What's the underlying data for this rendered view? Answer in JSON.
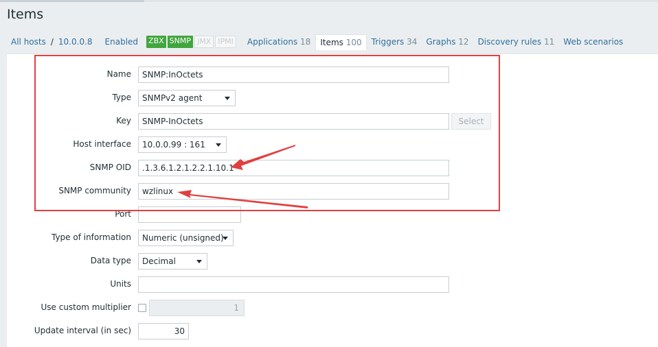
{
  "page": {
    "title": "Items"
  },
  "nav": {
    "all_hosts": "All hosts",
    "separator": "/",
    "host": "10.0.0.8",
    "status": "Enabled",
    "badges": [
      "ZBX",
      "SNMP",
      "JMX",
      "IPMI"
    ],
    "tabs": [
      {
        "label": "Applications",
        "count": "18"
      },
      {
        "label": "Items",
        "count": "100"
      },
      {
        "label": "Triggers",
        "count": "34"
      },
      {
        "label": "Graphs",
        "count": "12"
      },
      {
        "label": "Discovery rules",
        "count": "11"
      },
      {
        "label": "Web scenarios",
        "count": ""
      }
    ]
  },
  "form": {
    "name": {
      "label": "Name",
      "value": "SNMP:InOctets"
    },
    "type": {
      "label": "Type",
      "value": "SNMPv2 agent"
    },
    "key": {
      "label": "Key",
      "value": "SNMP-InOctets",
      "button": "Select"
    },
    "host_interface": {
      "label": "Host interface",
      "value": "10.0.0.99 : 161"
    },
    "snmp_oid": {
      "label": "SNMP OID",
      "value": ".1.3.6.1.2.1.2.2.1.10.1"
    },
    "snmp_community": {
      "label": "SNMP community",
      "value": "wzlinux"
    },
    "port": {
      "label": "Port",
      "value": ""
    },
    "type_of_information": {
      "label": "Type of information",
      "value": "Numeric (unsigned)"
    },
    "data_type": {
      "label": "Data type",
      "value": "Decimal"
    },
    "units": {
      "label": "Units",
      "value": ""
    },
    "custom_multiplier": {
      "label": "Use custom multiplier",
      "value": "1"
    },
    "update_interval": {
      "label": "Update interval (in sec)",
      "value": "30"
    }
  },
  "colors": {
    "annotation": "#e0403f",
    "link": "#2f6f9f",
    "enabled": "#3c9a36",
    "badge_active": "#41a63d"
  }
}
